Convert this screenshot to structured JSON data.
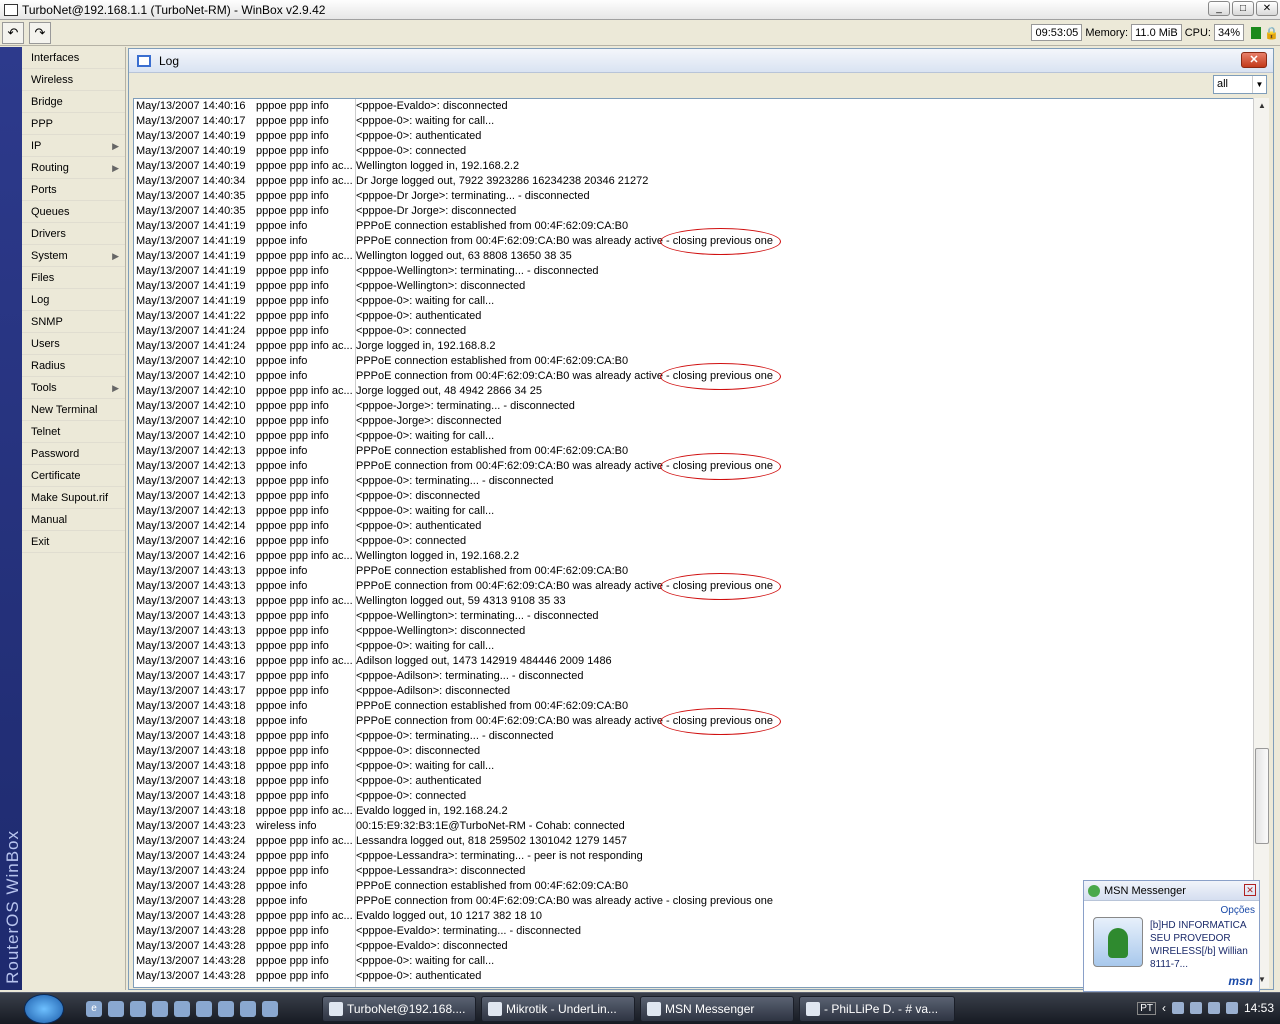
{
  "window": {
    "title": "TurboNet@192.168.1.1 (TurboNet-RM) - WinBox v2.9.42",
    "min": "_",
    "max": "□",
    "close": "✕"
  },
  "toolbar": {
    "undo": "↶",
    "redo": "↷",
    "time": "09:53:05",
    "memory_label": "Memory:",
    "memory": "11.0 MiB",
    "cpu_label": "CPU:",
    "cpu": "34%"
  },
  "brand": "RouterOS WinBox",
  "sidebar": {
    "items": [
      {
        "label": "Interfaces",
        "arrow": false
      },
      {
        "label": "Wireless",
        "arrow": false
      },
      {
        "label": "Bridge",
        "arrow": false
      },
      {
        "label": "PPP",
        "arrow": false
      },
      {
        "label": "IP",
        "arrow": true
      },
      {
        "label": "Routing",
        "arrow": true
      },
      {
        "label": "Ports",
        "arrow": false
      },
      {
        "label": "Queues",
        "arrow": false
      },
      {
        "label": "Drivers",
        "arrow": false
      },
      {
        "label": "System",
        "arrow": true
      },
      {
        "label": "Files",
        "arrow": false
      },
      {
        "label": "Log",
        "arrow": false
      },
      {
        "label": "SNMP",
        "arrow": false
      },
      {
        "label": "Users",
        "arrow": false
      },
      {
        "label": "Radius",
        "arrow": false
      },
      {
        "label": "Tools",
        "arrow": true
      },
      {
        "label": "New Terminal",
        "arrow": false
      },
      {
        "label": "Telnet",
        "arrow": false
      },
      {
        "label": "Password",
        "arrow": false
      },
      {
        "label": "Certificate",
        "arrow": false
      },
      {
        "label": "Make Supout.rif",
        "arrow": false
      },
      {
        "label": "Manual",
        "arrow": false
      },
      {
        "label": "Exit",
        "arrow": false
      }
    ]
  },
  "log": {
    "title": "Log",
    "close": "✕",
    "filter": "all",
    "entries": [
      [
        "May/13/2007 14:40:16",
        "pppoe ppp info",
        "<pppoe-Evaldo>: disconnected"
      ],
      [
        "May/13/2007 14:40:17",
        "pppoe ppp info",
        "<pppoe-0>: waiting for call..."
      ],
      [
        "May/13/2007 14:40:19",
        "pppoe ppp info",
        "<pppoe-0>: authenticated"
      ],
      [
        "May/13/2007 14:40:19",
        "pppoe ppp info",
        "<pppoe-0>: connected"
      ],
      [
        "May/13/2007 14:40:19",
        "pppoe ppp info ac...",
        "Wellington logged in, 192.168.2.2"
      ],
      [
        "May/13/2007 14:40:34",
        "pppoe ppp info ac...",
        "Dr Jorge logged out, 7922 3923286 16234238 20346 21272"
      ],
      [
        "May/13/2007 14:40:35",
        "pppoe ppp info",
        "<pppoe-Dr Jorge>: terminating... - disconnected"
      ],
      [
        "May/13/2007 14:40:35",
        "pppoe ppp info",
        "<pppoe-Dr Jorge>: disconnected"
      ],
      [
        "May/13/2007 14:41:19",
        "pppoe info",
        "PPPoE connection established from 00:4F:62:09:CA:B0"
      ],
      [
        "May/13/2007 14:41:19",
        "pppoe info",
        "PPPoE connection from 00:4F:62:09:CA:B0 was already active - closing previous one"
      ],
      [
        "May/13/2007 14:41:19",
        "pppoe ppp info ac...",
        "Wellington logged out, 63 8808 13650 38 35"
      ],
      [
        "May/13/2007 14:41:19",
        "pppoe ppp info",
        "<pppoe-Wellington>: terminating... - disconnected"
      ],
      [
        "May/13/2007 14:41:19",
        "pppoe ppp info",
        "<pppoe-Wellington>: disconnected"
      ],
      [
        "May/13/2007 14:41:19",
        "pppoe ppp info",
        "<pppoe-0>: waiting for call..."
      ],
      [
        "May/13/2007 14:41:22",
        "pppoe ppp info",
        "<pppoe-0>: authenticated"
      ],
      [
        "May/13/2007 14:41:24",
        "pppoe ppp info",
        "<pppoe-0>: connected"
      ],
      [
        "May/13/2007 14:41:24",
        "pppoe ppp info ac...",
        "Jorge logged in, 192.168.8.2"
      ],
      [
        "May/13/2007 14:42:10",
        "pppoe info",
        "PPPoE connection established from 00:4F:62:09:CA:B0"
      ],
      [
        "May/13/2007 14:42:10",
        "pppoe info",
        "PPPoE connection from 00:4F:62:09:CA:B0 was already active - closing previous one"
      ],
      [
        "May/13/2007 14:42:10",
        "pppoe ppp info ac...",
        "Jorge logged out, 48 4942 2866 34 25"
      ],
      [
        "May/13/2007 14:42:10",
        "pppoe ppp info",
        "<pppoe-Jorge>: terminating... - disconnected"
      ],
      [
        "May/13/2007 14:42:10",
        "pppoe ppp info",
        "<pppoe-Jorge>: disconnected"
      ],
      [
        "May/13/2007 14:42:10",
        "pppoe ppp info",
        "<pppoe-0>: waiting for call..."
      ],
      [
        "May/13/2007 14:42:13",
        "pppoe info",
        "PPPoE connection established from 00:4F:62:09:CA:B0"
      ],
      [
        "May/13/2007 14:42:13",
        "pppoe info",
        "PPPoE connection from 00:4F:62:09:CA:B0 was already active - closing previous one"
      ],
      [
        "May/13/2007 14:42:13",
        "pppoe ppp info",
        "<pppoe-0>: terminating... - disconnected"
      ],
      [
        "May/13/2007 14:42:13",
        "pppoe ppp info",
        "<pppoe-0>: disconnected"
      ],
      [
        "May/13/2007 14:42:13",
        "pppoe ppp info",
        "<pppoe-0>: waiting for call..."
      ],
      [
        "May/13/2007 14:42:14",
        "pppoe ppp info",
        "<pppoe-0>: authenticated"
      ],
      [
        "May/13/2007 14:42:16",
        "pppoe ppp info",
        "<pppoe-0>: connected"
      ],
      [
        "May/13/2007 14:42:16",
        "pppoe ppp info ac...",
        "Wellington logged in, 192.168.2.2"
      ],
      [
        "May/13/2007 14:43:13",
        "pppoe info",
        "PPPoE connection established from 00:4F:62:09:CA:B0"
      ],
      [
        "May/13/2007 14:43:13",
        "pppoe info",
        "PPPoE connection from 00:4F:62:09:CA:B0 was already active - closing previous one"
      ],
      [
        "May/13/2007 14:43:13",
        "pppoe ppp info ac...",
        "Wellington logged out, 59 4313 9108 35 33"
      ],
      [
        "May/13/2007 14:43:13",
        "pppoe ppp info",
        "<pppoe-Wellington>: terminating... - disconnected"
      ],
      [
        "May/13/2007 14:43:13",
        "pppoe ppp info",
        "<pppoe-Wellington>: disconnected"
      ],
      [
        "May/13/2007 14:43:13",
        "pppoe ppp info",
        "<pppoe-0>: waiting for call..."
      ],
      [
        "May/13/2007 14:43:16",
        "pppoe ppp info ac...",
        "Adilson logged out, 1473 142919 484446 2009 1486"
      ],
      [
        "May/13/2007 14:43:17",
        "pppoe ppp info",
        "<pppoe-Adilson>: terminating... - disconnected"
      ],
      [
        "May/13/2007 14:43:17",
        "pppoe ppp info",
        "<pppoe-Adilson>: disconnected"
      ],
      [
        "May/13/2007 14:43:18",
        "pppoe info",
        "PPPoE connection established from 00:4F:62:09:CA:B0"
      ],
      [
        "May/13/2007 14:43:18",
        "pppoe info",
        "PPPoE connection from 00:4F:62:09:CA:B0 was already active - closing previous one"
      ],
      [
        "May/13/2007 14:43:18",
        "pppoe ppp info",
        "<pppoe-0>: terminating... - disconnected"
      ],
      [
        "May/13/2007 14:43:18",
        "pppoe ppp info",
        "<pppoe-0>: disconnected"
      ],
      [
        "May/13/2007 14:43:18",
        "pppoe ppp info",
        "<pppoe-0>: waiting for call..."
      ],
      [
        "May/13/2007 14:43:18",
        "pppoe ppp info",
        "<pppoe-0>: authenticated"
      ],
      [
        "May/13/2007 14:43:18",
        "pppoe ppp info",
        "<pppoe-0>: connected"
      ],
      [
        "May/13/2007 14:43:18",
        "pppoe ppp info ac...",
        "Evaldo logged in, 192.168.24.2"
      ],
      [
        "May/13/2007 14:43:23",
        "wireless info",
        "00:15:E9:32:B3:1E@TurboNet-RM - Cohab: connected"
      ],
      [
        "May/13/2007 14:43:24",
        "pppoe ppp info ac...",
        "Lessandra logged out, 818 259502 1301042 1279 1457"
      ],
      [
        "May/13/2007 14:43:24",
        "pppoe ppp info",
        "<pppoe-Lessandra>: terminating... - peer is not responding"
      ],
      [
        "May/13/2007 14:43:24",
        "pppoe ppp info",
        "<pppoe-Lessandra>: disconnected"
      ],
      [
        "May/13/2007 14:43:28",
        "pppoe info",
        "PPPoE connection established from 00:4F:62:09:CA:B0"
      ],
      [
        "May/13/2007 14:43:28",
        "pppoe info",
        "PPPoE connection from 00:4F:62:09:CA:B0 was already active - closing previous one"
      ],
      [
        "May/13/2007 14:43:28",
        "pppoe ppp info ac...",
        "Evaldo logged out, 10 1217 382 18 10"
      ],
      [
        "May/13/2007 14:43:28",
        "pppoe ppp info",
        "<pppoe-Evaldo>: terminating... - disconnected"
      ],
      [
        "May/13/2007 14:43:28",
        "pppoe ppp info",
        "<pppoe-Evaldo>: disconnected"
      ],
      [
        "May/13/2007 14:43:28",
        "pppoe ppp info",
        "<pppoe-0>: waiting for call..."
      ],
      [
        "May/13/2007 14:43:28",
        "pppoe ppp info",
        "<pppoe-0>: authenticated"
      ]
    ],
    "highlight_rows": [
      9,
      18,
      24,
      32,
      41
    ],
    "highlight_text": "- closing previous one"
  },
  "msn": {
    "title": "MSN Messenger",
    "options": "Opções",
    "message": "[b]HD INFORMATICA SEU PROVEDOR WIRELESS[/b] Willian 8111-7...",
    "logo": "msn"
  },
  "taskbar": {
    "tasks": [
      "TurboNet@192.168....",
      "Mikrotik - UnderLin...",
      "MSN Messenger",
      "- PhiLLiPe D. - # va..."
    ],
    "lang": "PT",
    "clock": "14:53"
  },
  "colors": {
    "highlight": "#d01010",
    "brand_strip": "#2d3a8c"
  }
}
